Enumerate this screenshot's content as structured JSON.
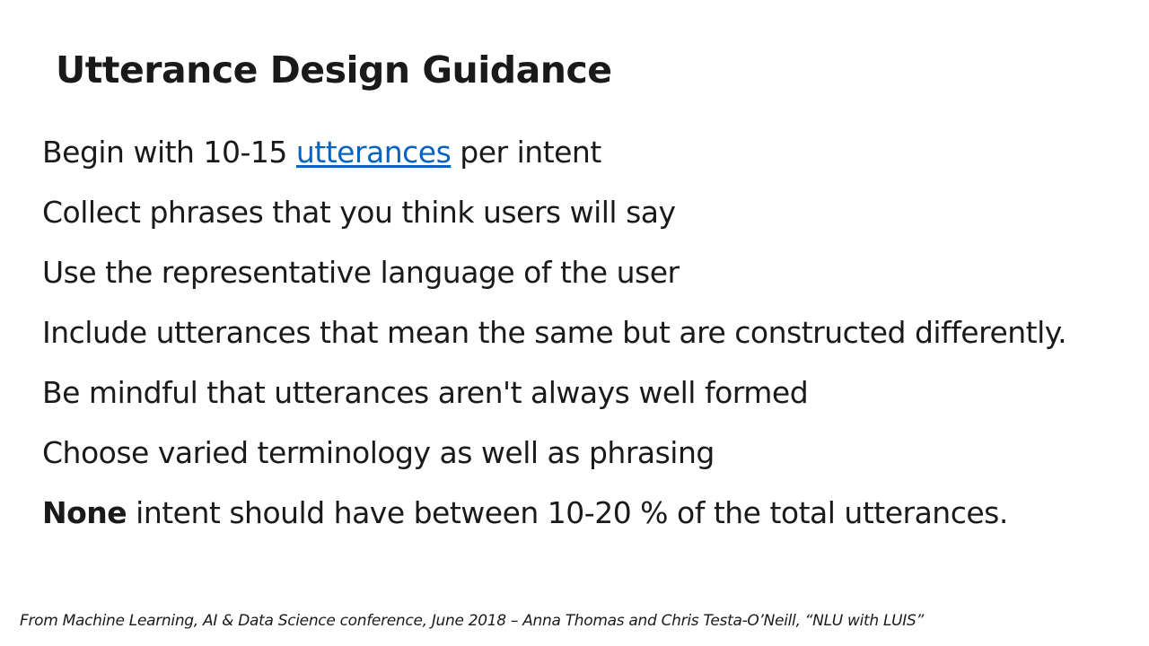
{
  "slide": {
    "title": "Utterance Design Guidance",
    "bullets": [
      {
        "prefix": "Begin with 10-15 ",
        "link_text": "utterances",
        "suffix": " per intent"
      },
      {
        "text": "Collect phrases that you think users will say"
      },
      {
        "text": "Use the representative language of the user"
      },
      {
        "text": "Include utterances that mean the same but are constructed differently."
      },
      {
        "text": "Be mindful that utterances aren't always well formed"
      },
      {
        "text": "Choose varied terminology as well as phrasing"
      },
      {
        "bold": "None",
        "text": " intent should have between 10-20 % of the total utterances."
      }
    ],
    "footer": "From Machine Learning, AI & Data Science conference, June 2018 – Anna Thomas and Chris Testa-O’Neill,  “NLU with LUIS”"
  },
  "colors": {
    "text": "#1a1a1a",
    "link": "#0563c1",
    "background": "#ffffff"
  }
}
